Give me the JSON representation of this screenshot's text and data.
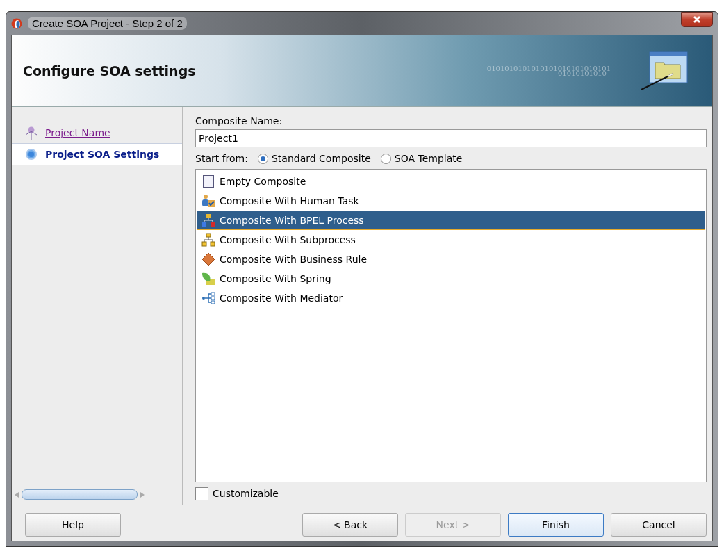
{
  "window": {
    "title": "Create SOA Project - Step 2 of 2"
  },
  "header": {
    "title": "Configure SOA settings",
    "binary_text": "0101010101010101010101010101",
    "binary_text_2": "01010101010"
  },
  "steps": [
    {
      "label": "Project Name",
      "selected": false,
      "visited": true
    },
    {
      "label": "Project SOA Settings",
      "selected": true,
      "visited": false
    }
  ],
  "composite_name": {
    "label": "Composite Name:",
    "value": "Project1"
  },
  "start_from": {
    "label": "Start from:",
    "options": [
      {
        "label": "Standard Composite",
        "selected": true
      },
      {
        "label": "SOA Template",
        "selected": false
      }
    ]
  },
  "templates": [
    {
      "kind": "empty",
      "label": "Empty Composite",
      "selected": false
    },
    {
      "kind": "human",
      "label": "Composite With Human Task",
      "selected": false
    },
    {
      "kind": "bpel",
      "label": "Composite With BPEL Process",
      "selected": true
    },
    {
      "kind": "subprocess",
      "label": "Composite With Subprocess",
      "selected": false
    },
    {
      "kind": "rule",
      "label": "Composite With Business Rule",
      "selected": false
    },
    {
      "kind": "spring",
      "label": "Composite With Spring",
      "selected": false
    },
    {
      "kind": "mediator",
      "label": "Composite With Mediator",
      "selected": false
    }
  ],
  "customizable": {
    "label": "Customizable",
    "checked": false
  },
  "buttons": [
    {
      "label": "Help",
      "disabled": false,
      "default": false
    },
    {
      "label": "< Back",
      "disabled": false,
      "default": false
    },
    {
      "label": "Next >",
      "disabled": true,
      "default": false
    },
    {
      "label": "Finish",
      "disabled": false,
      "default": true
    },
    {
      "label": "Cancel",
      "disabled": false,
      "default": false
    }
  ]
}
